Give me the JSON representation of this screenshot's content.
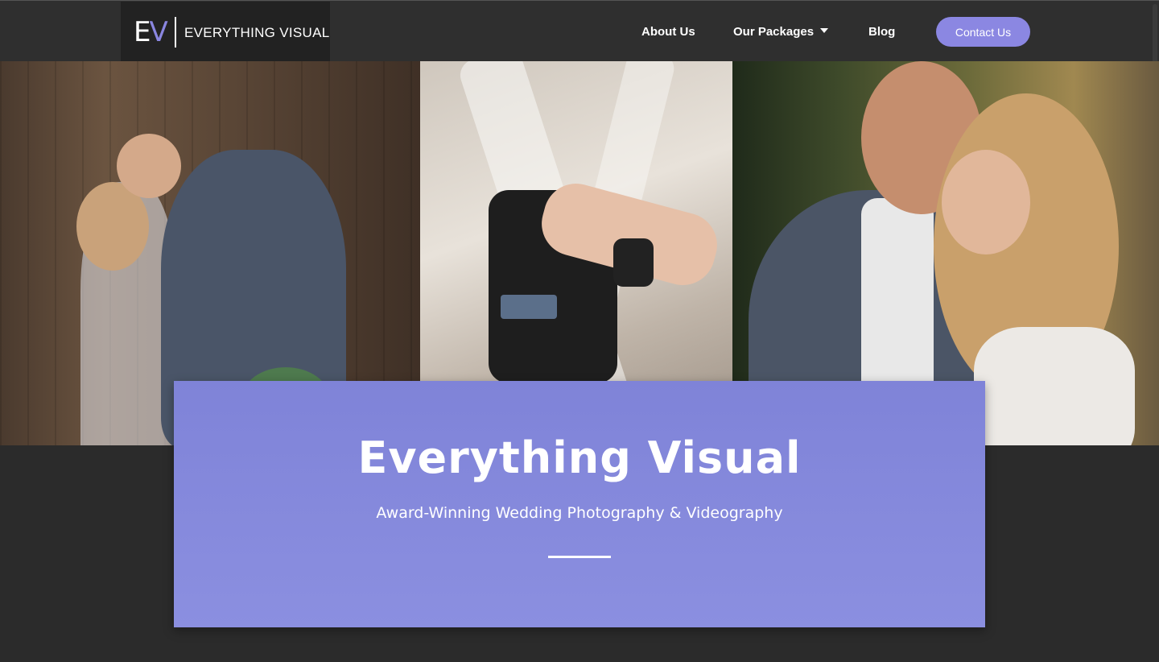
{
  "brand": {
    "logo_mark_e": "E",
    "logo_mark_v": "V",
    "logo_text": "EVERYTHING VISUAL",
    "accent_color": "#8b87e2"
  },
  "nav": {
    "items": [
      {
        "label": "About Us"
      },
      {
        "label": "Our Packages",
        "has_dropdown": true
      },
      {
        "label": "Blog"
      }
    ],
    "contact_label": "Contact Us"
  },
  "hero": {
    "photos": [
      "couple-kiss-photo",
      "camera-operator-photo",
      "couple-embrace-photo"
    ]
  },
  "feature": {
    "title": "Everything Visual",
    "subtitle": "Award-Winning Wedding Photography & Videography"
  }
}
